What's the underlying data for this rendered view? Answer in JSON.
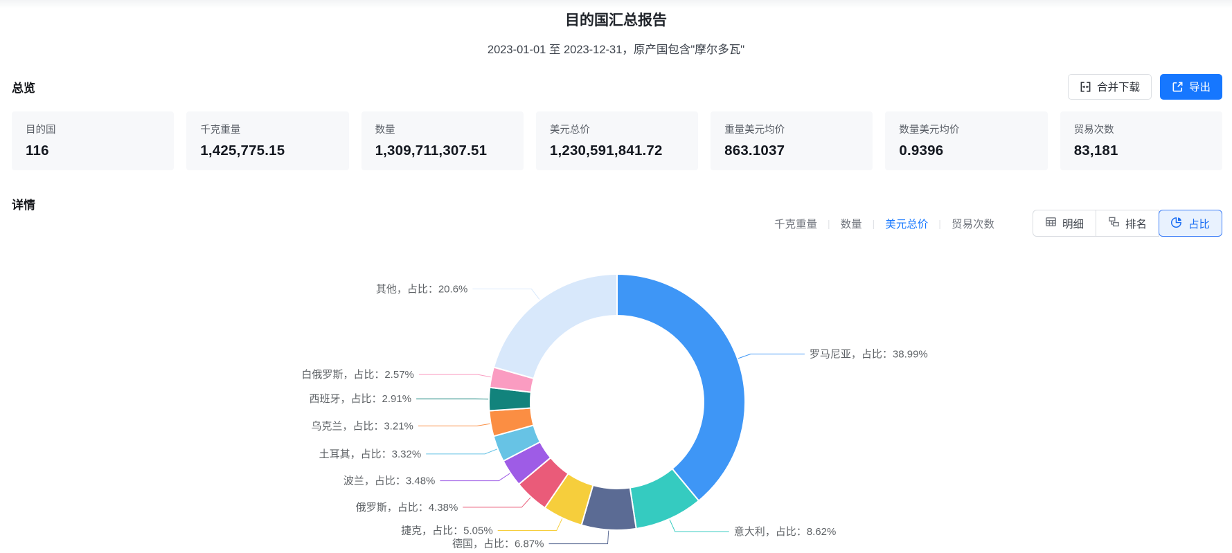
{
  "header": {
    "title": "目的国汇总报告",
    "subtitle": "2023-01-01 至 2023-12-31，原产国包含\"摩尔多瓦\""
  },
  "toolbar": {
    "merge_download_label": "合并下载",
    "export_label": "导出"
  },
  "overview": {
    "heading": "总览",
    "cards": [
      {
        "label": "目的国",
        "value": "116"
      },
      {
        "label": "千克重量",
        "value": "1,425,775.15"
      },
      {
        "label": "数量",
        "value": "1,309,711,307.51"
      },
      {
        "label": "美元总价",
        "value": "1,230,591,841.72"
      },
      {
        "label": "重量美元均价",
        "value": "863.1037"
      },
      {
        "label": "数量美元均价",
        "value": "0.9396"
      },
      {
        "label": "贸易次数",
        "value": "83,181"
      }
    ]
  },
  "details": {
    "heading": "详情",
    "metric_tabs": [
      {
        "label": "千克重量",
        "active": false
      },
      {
        "label": "数量",
        "active": false
      },
      {
        "label": "美元总价",
        "active": true
      },
      {
        "label": "贸易次数",
        "active": false
      }
    ],
    "view_buttons": [
      {
        "label": "明细",
        "icon": "table-icon",
        "active": false
      },
      {
        "label": "排名",
        "icon": "rank-icon",
        "active": false
      },
      {
        "label": "占比",
        "icon": "pie-icon",
        "active": true
      }
    ]
  },
  "chart_data": {
    "type": "pie",
    "subtype": "donut",
    "label_mid": "，占比：",
    "label_suffix": "%",
    "legend_position": "none",
    "series": [
      {
        "name": "罗马尼亚",
        "value": 38.99,
        "color": "#3E96F6"
      },
      {
        "name": "意大利",
        "value": 8.62,
        "color": "#35CBC0"
      },
      {
        "name": "德国",
        "value": 6.87,
        "color": "#5B6B94"
      },
      {
        "name": "捷克",
        "value": 5.05,
        "color": "#F6CE3C"
      },
      {
        "name": "俄罗斯",
        "value": 4.38,
        "color": "#EA5B79"
      },
      {
        "name": "波兰",
        "value": 3.48,
        "color": "#9E5CE6"
      },
      {
        "name": "土耳其",
        "value": 3.32,
        "color": "#67C3E5"
      },
      {
        "name": "乌克兰",
        "value": 3.21,
        "color": "#FB8E43"
      },
      {
        "name": "西班牙",
        "value": 2.91,
        "color": "#12837C"
      },
      {
        "name": "白俄罗斯",
        "value": 2.57,
        "color": "#FA9CC1"
      },
      {
        "name": "其他",
        "value": 20.6,
        "color": "#D8E8FB"
      }
    ]
  }
}
